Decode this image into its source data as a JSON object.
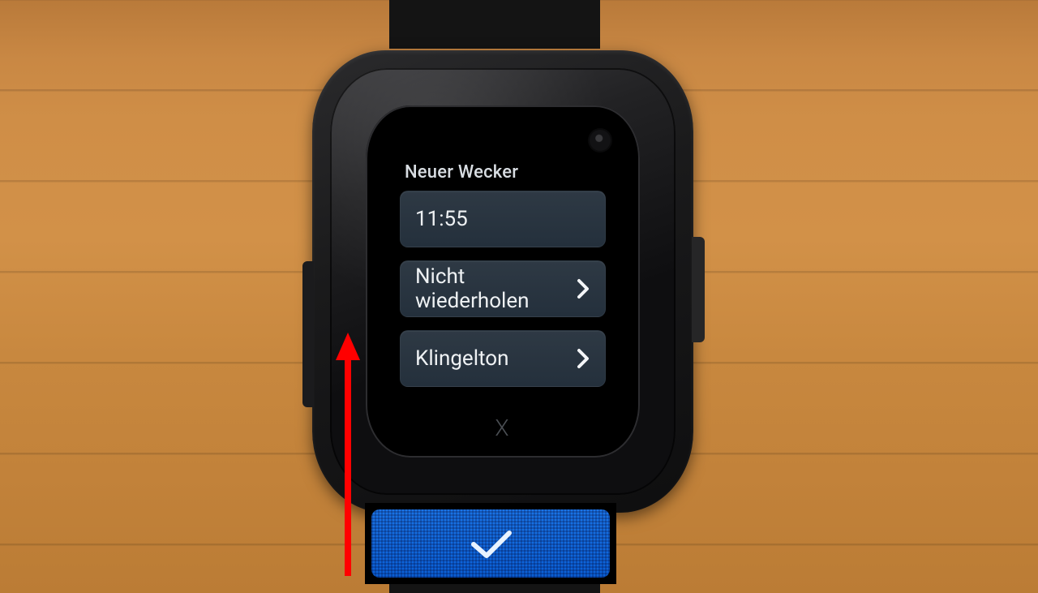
{
  "screen": {
    "title": "Neuer Wecker",
    "items": [
      {
        "label": "11:55",
        "has_chevron": false
      },
      {
        "label": "Nicht wiederholen",
        "has_chevron": true
      },
      {
        "label": "Klingelton",
        "has_chevron": true
      }
    ],
    "home_button_glyph": "X"
  },
  "callout": {
    "button_icon": "check-icon"
  },
  "annotation": {
    "type": "arrow-up",
    "color": "#ff0000"
  },
  "colors": {
    "item_bg": "#2b3742",
    "screen_bg": "#000000",
    "confirm_bg": "#1168df",
    "arrow": "#ff0000"
  }
}
